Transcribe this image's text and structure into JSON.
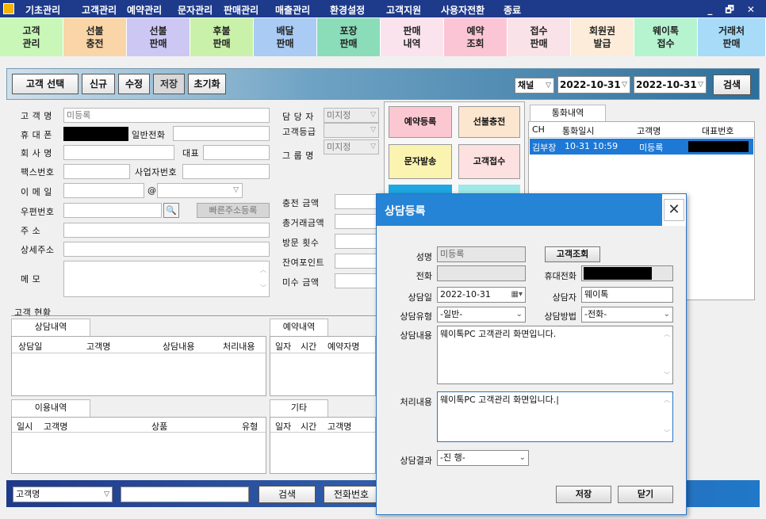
{
  "menubar": {
    "items": [
      "기초관리",
      "고객관리",
      "예약관리",
      "문자관리",
      "판매관리",
      "매출관리",
      "환경설정",
      "고객지원",
      "사용자전환",
      "종료"
    ],
    "window_controls": "_ 🗗 ✕"
  },
  "tiles": [
    {
      "l1": "고객",
      "l2": "관리",
      "color": "#c8f7b8"
    },
    {
      "l1": "선불",
      "l2": "충전",
      "color": "#f9d5a7"
    },
    {
      "l1": "선불",
      "l2": "판매",
      "color": "#cdc7f4"
    },
    {
      "l1": "후불",
      "l2": "판매",
      "color": "#c9f1a9"
    },
    {
      "l1": "배달",
      "l2": "판매",
      "color": "#a9cbf4"
    },
    {
      "l1": "포장",
      "l2": "판매",
      "color": "#8bdcb9"
    },
    {
      "l1": "판매",
      "l2": "내역",
      "color": "#fbe3ee"
    },
    {
      "l1": "예약",
      "l2": "조회",
      "color": "#fbc5d6"
    },
    {
      "l1": "접수",
      "l2": "판매",
      "color": "#f9e3e9"
    },
    {
      "l1": "회원권",
      "l2": "발급",
      "color": "#fdecd9"
    },
    {
      "l1": "웨이톡",
      "l2": "접수",
      "color": "#b6f4d0"
    },
    {
      "l1": "거래처",
      "l2": "판매",
      "color": "#a7dbf8"
    }
  ],
  "toolbar": {
    "customer_select": "고객 선택",
    "new": "신규",
    "edit": "수정",
    "save": "저장",
    "reset": "초기화",
    "channel": "채널",
    "date_from": "2022-10-31",
    "date_to": "2022-10-31",
    "search": "검색"
  },
  "form": {
    "name_label": "고 객 명",
    "name_value": "미등록",
    "mobile_label": "휴 대 폰",
    "phone_label": "일반전화",
    "company_label": "회 사 명",
    "ceo_label": "대표",
    "fax_label": "팩스번호",
    "bizno_label": "사업자번호",
    "email_label": "이 메 일",
    "at": "@",
    "zip_label": "우편번호",
    "quick_addr": "빠른주소등록",
    "addr_label": "주      소",
    "addr_detail_label": "상세주소",
    "memo_label": "메      모",
    "manager_label": "담 당 자",
    "manager_value": "미지정",
    "grade_label": "고객등급",
    "group_label": "그 룹 명",
    "group_value": "미지정",
    "charge_label": "충전 금액",
    "total_label": "총거래금액",
    "visit_label": "방문 횟수",
    "points_label": "잔여포인트",
    "unpaid_label": "미수 금액"
  },
  "actions": {
    "reserve": "예약등록",
    "prepaid": "선불충전",
    "sms": "문자발송",
    "receipt": "고객접수"
  },
  "calls": {
    "tab": "통화내역",
    "headers": [
      "CH",
      "통화일시",
      "고객명",
      "대표번호"
    ],
    "rows": [
      {
        "ch": "김부장",
        "time": "10-31 10:59",
        "name": "미등록"
      }
    ]
  },
  "status": {
    "title": "고객 현황",
    "consult_tab": "상담내역",
    "consult_headers": [
      "상담일",
      "고객명",
      "상담내용",
      "처리내용"
    ],
    "reserve_tab": "예약내역",
    "reserve_headers": [
      "일자",
      "시간",
      "예약자명"
    ],
    "usage_tab": "이용내역",
    "usage_headers": [
      "일시",
      "고객명",
      "상품",
      "유형"
    ],
    "etc_tab": "기타",
    "etc_headers": [
      "일자",
      "시간",
      "고객명"
    ]
  },
  "bottom": {
    "select": "고객명",
    "search": "검색",
    "phone": "전화번호"
  },
  "dialog": {
    "title": "상담등록",
    "name_label": "성명",
    "name_value": "미등록",
    "lookup": "고객조회",
    "phone_label": "전화",
    "mobile_label": "휴대전화",
    "date_label": "상담일",
    "date_value": "2022-10-31",
    "agent_label": "상담자",
    "agent_value": "웨이톡",
    "type_label": "상담유형",
    "type_value": "-일반-",
    "method_label": "상담방법",
    "method_value": "-전화-",
    "content_label": "상담내용",
    "content_value": "웨이톡PC 고객관리 화면입니다.",
    "process_label": "처리내용",
    "process_value": "웨이톡PC 고객관리 화면입니다.|",
    "result_label": "상담결과",
    "result_value": "-진 행-",
    "save": "저장",
    "close": "닫기"
  }
}
